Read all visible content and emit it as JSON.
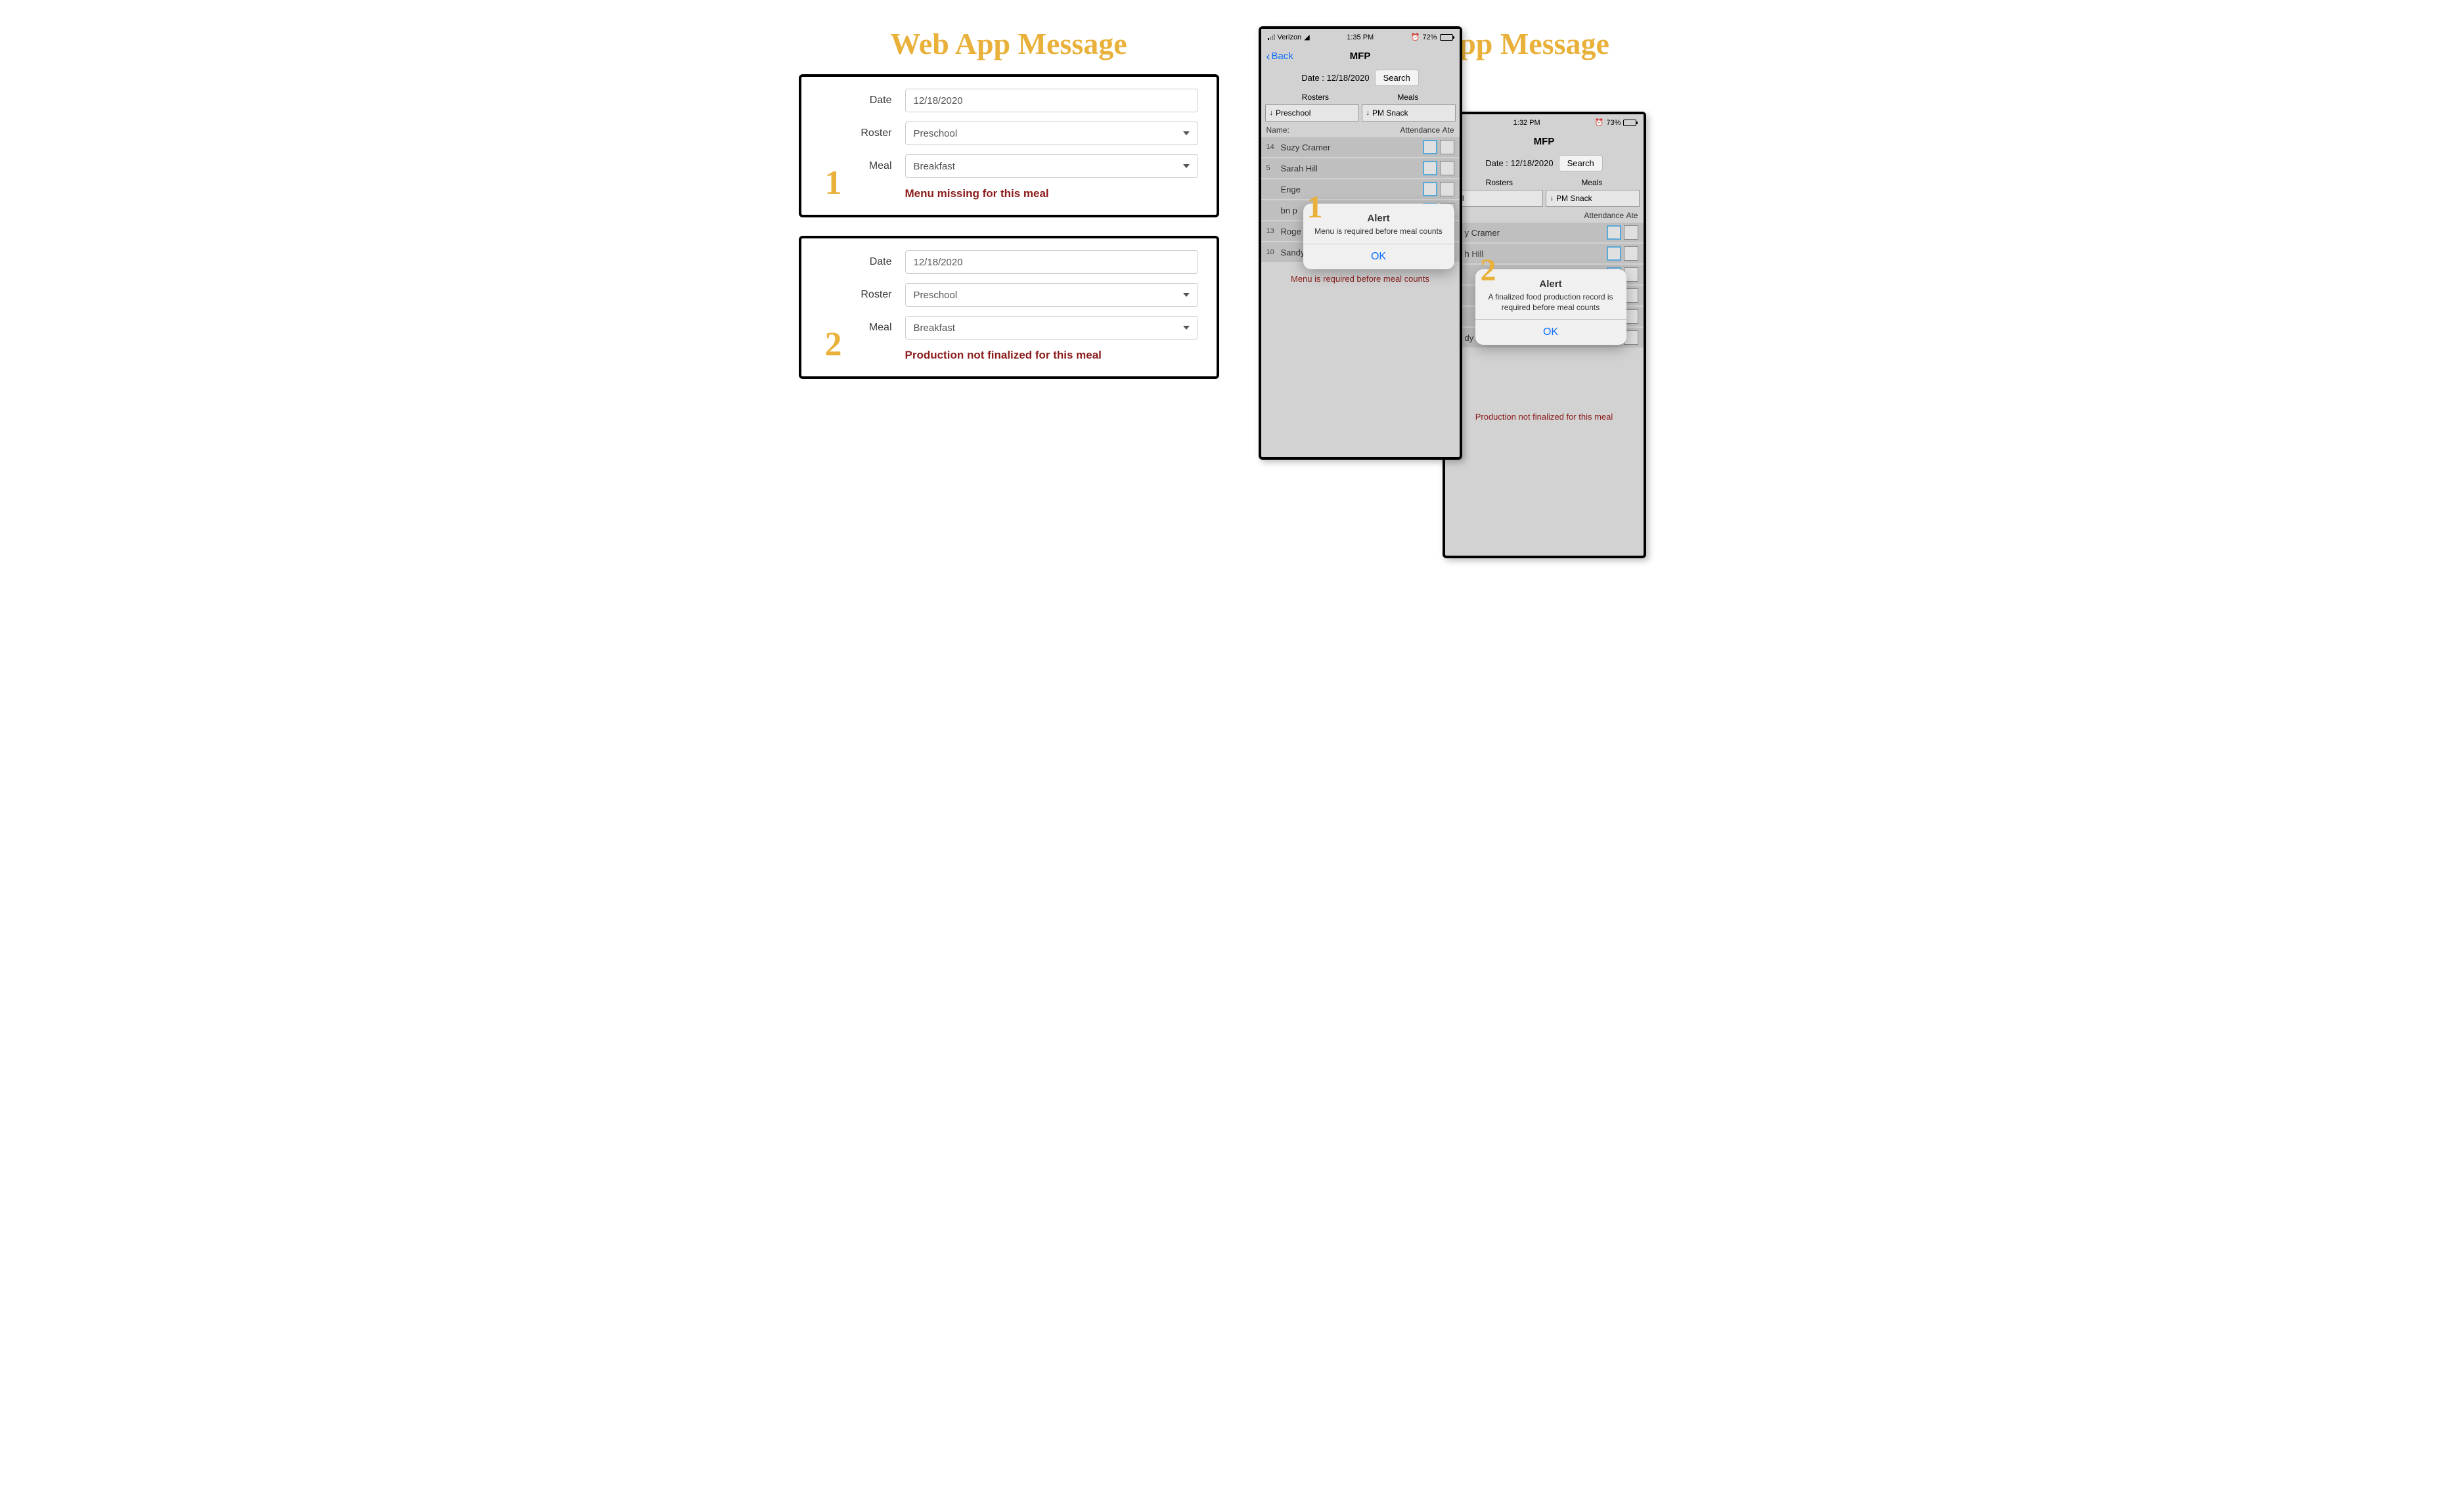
{
  "headings": {
    "web": "Web App Message",
    "mobile": "Mobile App Message"
  },
  "annotations": {
    "num1": "1",
    "num2": "2"
  },
  "web": {
    "labels": {
      "date": "Date",
      "roster": "Roster",
      "meal": "Meal"
    },
    "card1": {
      "date": "12/18/2020",
      "roster": "Preschool",
      "meal": "Breakfast",
      "error": "Menu missing for this meal"
    },
    "card2": {
      "date": "12/18/2020",
      "roster": "Preschool",
      "meal": "Breakfast",
      "error": "Production not finalized for this meal"
    }
  },
  "mobile": {
    "common": {
      "back": "Back",
      "title": "MFP",
      "date_label": "Date : 12/18/2020",
      "search": "Search",
      "rosters_header": "Rosters",
      "meals_header": "Meals",
      "name_label": "Name:",
      "attendance_label": "Attendance",
      "ate_label": "Ate",
      "ok": "OK",
      "alert_title": "Alert"
    },
    "phone1": {
      "carrier": "Verizon",
      "time": "1:35 PM",
      "battery_pct": "72%",
      "roster_dd": "Preschool",
      "meal_dd": "PM Snack",
      "rows": [
        {
          "num": "14",
          "name": "Suzy Cramer"
        },
        {
          "num": "5",
          "name": "Sarah Hill"
        },
        {
          "num": "",
          "name": "Enge"
        },
        {
          "num": "",
          "name": "bn p"
        },
        {
          "num": "13",
          "name": "Roge"
        },
        {
          "num": "10",
          "name": "Sandy Smith"
        }
      ],
      "alert_msg": "Menu is required before meal counts",
      "bottom_error": "Menu is required before meal counts"
    },
    "phone2": {
      "time": "1:32 PM",
      "battery_pct": "73%",
      "roster_dd": "ool",
      "meal_dd": "PM Snack",
      "rows": [
        {
          "num": "",
          "name": "y Cramer"
        },
        {
          "num": "",
          "name": "h Hill"
        },
        {
          "num": "",
          "name": ""
        },
        {
          "num": "",
          "name": ""
        },
        {
          "num": "",
          "name": ""
        },
        {
          "num": "",
          "name": "dy Smith"
        }
      ],
      "alert_msg": "A finalized food production record is required before meal counts",
      "bottom_error": "Production not finalized for this meal"
    }
  }
}
